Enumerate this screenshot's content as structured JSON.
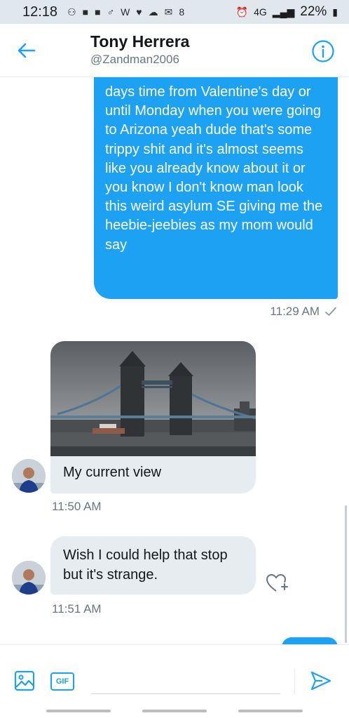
{
  "status_bar": {
    "time": "12:18",
    "battery": "22%",
    "network": "4G"
  },
  "header": {
    "title": "Tony Herrera",
    "handle": "@Zandman2006"
  },
  "messages": {
    "sent_text": "days time from Valentine's day or until Monday when you were going to Arizona yeah dude that's some trippy shit and it's almost seems like you already know about it or you know I don't know man look this weird asylum SE giving me the heebie-jeebies as my mom would say",
    "sent_time": "11:29 AM",
    "photo_caption": "My current view",
    "photo_time": "11:50 AM",
    "received_text": "Wish I could help that stop but it's strange.",
    "received_time": "11:51 AM"
  },
  "composer": {
    "gif_label": "GIF",
    "placeholder": ""
  },
  "colors": {
    "accent": "#1da1f2",
    "received_bubble": "#e6ecf0",
    "muted_text": "#657786"
  },
  "icons": [
    "back-arrow-icon",
    "info-icon",
    "checkmark-icon",
    "heart-plus-icon",
    "image-icon",
    "send-icon"
  ]
}
